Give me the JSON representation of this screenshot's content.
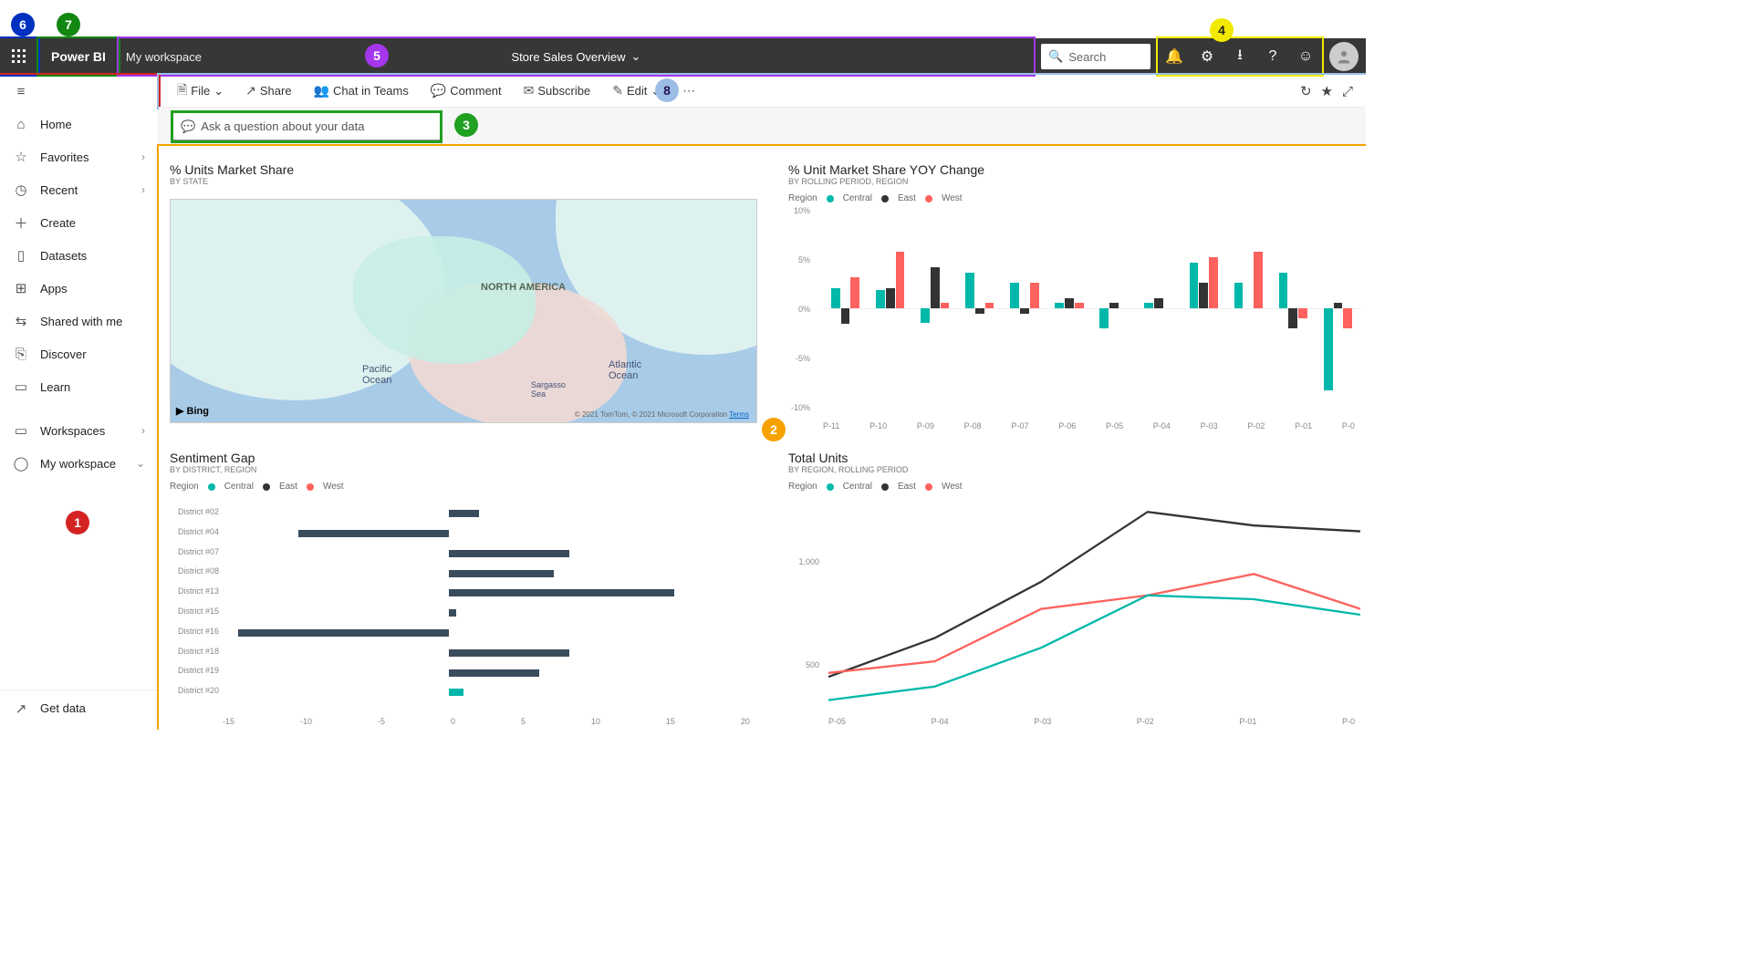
{
  "topbar": {
    "brand": "Power BI",
    "workspace": "My workspace",
    "dashboard": "Store Sales Overview",
    "search_placeholder": "Search"
  },
  "header_icons": [
    "bell",
    "gear",
    "download",
    "help",
    "smile"
  ],
  "sidebar": {
    "hamburger": "≡",
    "items": [
      {
        "icon": "⌂",
        "label": "Home"
      },
      {
        "icon": "☆",
        "label": "Favorites",
        "chev": "›"
      },
      {
        "icon": "◷",
        "label": "Recent",
        "chev": "›"
      },
      {
        "icon": "＋",
        "label": "Create"
      },
      {
        "icon": "▯",
        "label": "Datasets"
      },
      {
        "icon": "⊞",
        "label": "Apps"
      },
      {
        "icon": "⇆",
        "label": "Shared with me"
      },
      {
        "icon": "⎘",
        "label": "Discover"
      },
      {
        "icon": "▭",
        "label": "Learn"
      },
      {
        "icon": "▭",
        "label": "Workspaces",
        "chev": "›",
        "section": true
      },
      {
        "icon": "◯",
        "label": "My workspace",
        "chev": "⌄"
      }
    ],
    "footer": {
      "icon": "↗",
      "label": "Get data"
    }
  },
  "actions": [
    {
      "icon": "🗎",
      "label": "File",
      "chev": "⌄"
    },
    {
      "icon": "↗",
      "label": "Share"
    },
    {
      "icon": "👥",
      "label": "Chat in Teams"
    },
    {
      "icon": "💬",
      "label": "Comment"
    },
    {
      "icon": "✉",
      "label": "Subscribe"
    },
    {
      "icon": "✎",
      "label": "Edit",
      "chev": "⌄"
    },
    {
      "icon": "⋯",
      "label": ""
    }
  ],
  "action_right": [
    "↻",
    "★",
    "⤢"
  ],
  "qna_placeholder": "Ask a question about your data",
  "badges": {
    "1": "1",
    "2": "2",
    "3": "3",
    "4": "4",
    "5": "5",
    "6": "6",
    "7": "7",
    "8": "8"
  },
  "tiles": {
    "map": {
      "title": "% Units Market Share",
      "sub": "By State",
      "label": "NORTH AMERICA",
      "pacific": "Pacific\nOcean",
      "atlantic": "Atlantic\nOcean",
      "sargasso": "Sargasso\nSea",
      "bing": "Bing",
      "copyright": "© 2021 TomTom, © 2021 Microsoft Corporation  ",
      "terms": "Terms"
    },
    "yoy": {
      "title": "% Unit Market Share YOY Change",
      "sub": "By Rolling Period, Region",
      "legend_label": "Region",
      "regions": [
        "Central",
        "East",
        "West"
      ]
    },
    "sentiment": {
      "title": "Sentiment Gap",
      "sub": "By District, Region",
      "legend_label": "Region",
      "regions": [
        "Central",
        "East",
        "West"
      ]
    },
    "totals": {
      "title": "Total Units",
      "sub": "By Region, Rolling Period",
      "legend_label": "Region",
      "regions": [
        "Central",
        "East",
        "West"
      ]
    }
  },
  "chart_data": [
    {
      "id": "yoy",
      "type": "bar",
      "title": "% Unit Market Share YOY Change",
      "xlabel": "",
      "ylabel": "",
      "ylim": [
        -10,
        10
      ],
      "yticks": [
        "10%",
        "5%",
        "0%",
        "-5%",
        "-10%"
      ],
      "categories": [
        "P-11",
        "P-10",
        "P-09",
        "P-08",
        "P-07",
        "P-06",
        "P-05",
        "P-04",
        "P-03",
        "P-02",
        "P-01",
        "P-0"
      ],
      "series": [
        {
          "name": "Central",
          "color": "#00b8aa",
          "values": [
            2.0,
            1.8,
            -1.4,
            3.5,
            2.5,
            0.5,
            -2.0,
            0.5,
            4.5,
            2.5,
            3.5,
            -8.0
          ]
        },
        {
          "name": "East",
          "color": "#333333",
          "values": [
            -1.5,
            2.0,
            4.0,
            -0.5,
            -0.5,
            1.0,
            0.5,
            1.0,
            2.5,
            0.0,
            -2.0,
            0.5
          ]
        },
        {
          "name": "West",
          "color": "#fd625e",
          "values": [
            3.0,
            5.5,
            0.5,
            0.5,
            2.5,
            0.5,
            0.0,
            0.0,
            5.0,
            5.5,
            -1.0,
            -2.0
          ]
        }
      ]
    },
    {
      "id": "sentiment",
      "type": "bar",
      "orientation": "horizontal",
      "title": "Sentiment Gap",
      "xlim": [
        -15,
        20
      ],
      "xticks": [
        "-15",
        "-10",
        "-5",
        "0",
        "5",
        "10",
        "15",
        "20"
      ],
      "categories": [
        "District #02",
        "District #04",
        "District #07",
        "District #08",
        "District #13",
        "District #15",
        "District #16",
        "District #18",
        "District #19",
        "District #20"
      ],
      "series": [
        {
          "name": "value",
          "color": "#3a4b5c",
          "values": [
            2,
            -10,
            8,
            7,
            15,
            0.5,
            -14,
            8,
            6,
            0
          ]
        }
      ],
      "extra": [
        {
          "category": "District #20",
          "color": "#00b8aa",
          "value": 1
        }
      ]
    },
    {
      "id": "totals",
      "type": "line",
      "title": "Total Units",
      "ylim": [
        300,
        1400
      ],
      "yticks": [
        "1,000",
        "500"
      ],
      "x": [
        "P-05",
        "P-04",
        "P-03",
        "P-02",
        "P-01",
        "P-0"
      ],
      "series": [
        {
          "name": "East",
          "color": "#333333",
          "values": [
            450,
            650,
            940,
            1300,
            1230,
            1200
          ]
        },
        {
          "name": "West",
          "color": "#fd625e",
          "values": [
            470,
            530,
            800,
            870,
            980,
            800
          ]
        },
        {
          "name": "Central",
          "color": "#00b8aa",
          "values": [
            330,
            400,
            600,
            870,
            850,
            770
          ]
        }
      ]
    }
  ]
}
